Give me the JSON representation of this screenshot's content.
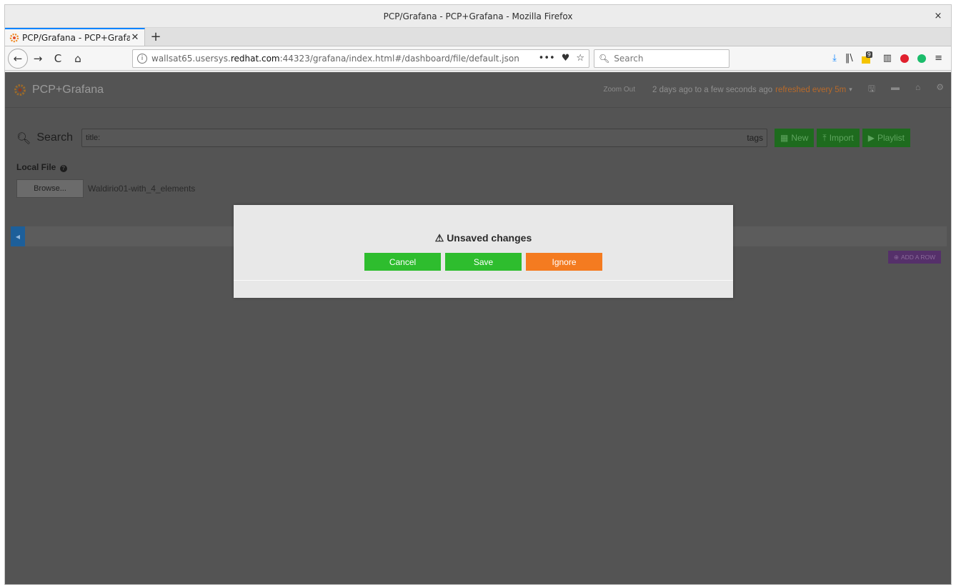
{
  "window": {
    "title": "PCP/Grafana - PCP+Grafana - Mozilla Firefox",
    "close_glyph": "×"
  },
  "tabs": [
    {
      "label": "PCP/Grafana - PCP+Grafa",
      "close_glyph": "✕"
    }
  ],
  "newtab_glyph": "+",
  "nav": {
    "back": "←",
    "forward": "→",
    "reload": "C",
    "home": "⌂",
    "url_prefix": "wallsat65.usersys.",
    "url_domain": "redhat.com",
    "url_suffix": ":44323/grafana/index.html#/dashboard/file/default.json",
    "search_placeholder": "Search",
    "info_glyph": "i",
    "page_actions": "•••",
    "pocket": "♥",
    "star": "☆",
    "badge_count": "9"
  },
  "grafana": {
    "brand": "PCP+Grafana",
    "zoom_out": "Zoom Out",
    "time_range": "2 days ago to a few seconds ago",
    "refresh": "refreshed every 5m",
    "search_label": "Search",
    "search_value": "title:",
    "tags_label": "tags",
    "buttons": {
      "new": "New",
      "import": "Import",
      "playlist": "Playlist"
    },
    "local_file_label": "Local File",
    "browse_label": "Browse...",
    "file_name": "Waldirio01-with_4_elements",
    "add_row": "ADD A ROW"
  },
  "modal": {
    "title": "Unsaved changes",
    "buttons": {
      "cancel": "Cancel",
      "save": "Save",
      "ignore": "Ignore"
    }
  },
  "colors": {
    "save_green": "#2ebd2e",
    "ignore_orange": "#f47b20",
    "grafana_bg": "#545454"
  }
}
